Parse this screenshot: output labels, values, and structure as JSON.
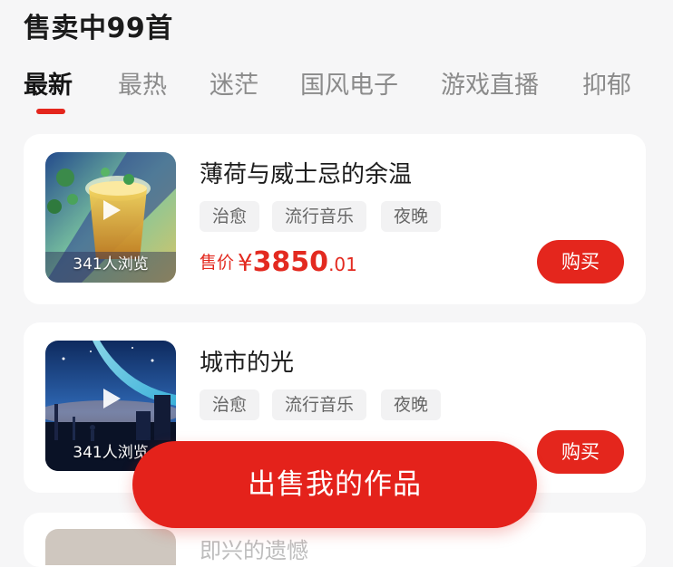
{
  "header": {
    "title": "售卖中99首"
  },
  "tabs": [
    {
      "label": "最新",
      "active": true
    },
    {
      "label": "最热"
    },
    {
      "label": "迷茫"
    },
    {
      "label": "国风电子"
    },
    {
      "label": "游戏直播"
    },
    {
      "label": "抑郁"
    }
  ],
  "cards": [
    {
      "title": "薄荷与威士忌的余温",
      "views": "341人浏览",
      "tags": [
        "治愈",
        "流行音乐",
        "夜晚"
      ],
      "price_label": "售价",
      "currency": "¥",
      "price_int": "3850",
      "price_dec": ".01",
      "buy_label": "购买"
    },
    {
      "title": "城市的光",
      "views": "341人浏览",
      "tags": [
        "治愈",
        "流行音乐",
        "夜晚"
      ],
      "buy_label": "购买"
    },
    {
      "title": "即兴的遗憾"
    }
  ],
  "sell_button": {
    "label": "出售我的作品"
  },
  "colors": {
    "accent": "#e4261d",
    "price": "#e32a20",
    "background": "#f6f6f7"
  }
}
